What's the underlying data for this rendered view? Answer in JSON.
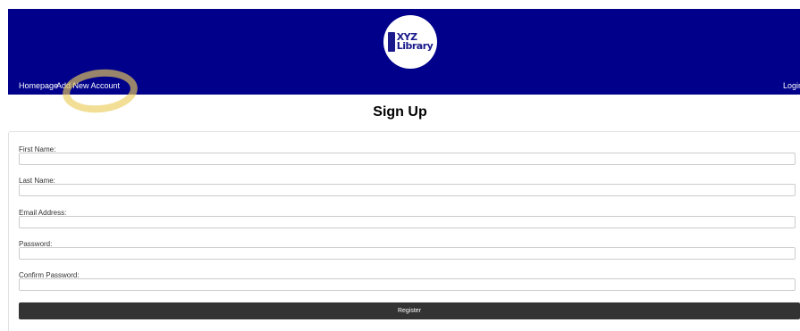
{
  "header": {
    "bg_color": "#00008b",
    "logo": {
      "line1": "XYZ",
      "line2": "Library",
      "tagline": ""
    },
    "nav": {
      "home": "Homepage",
      "add_account": "Add New Account",
      "login": "Login"
    }
  },
  "main": {
    "title": "Sign Up",
    "fields": [
      {
        "label": "First Name:",
        "value": ""
      },
      {
        "label": "Last Name:",
        "value": ""
      },
      {
        "label": "Email Address:",
        "value": ""
      },
      {
        "label": "Password:",
        "value": ""
      },
      {
        "label": "Confirm Password:",
        "value": ""
      }
    ],
    "register_label": "Register"
  },
  "annotation": {
    "highlight_color": "#ebcd5a"
  }
}
